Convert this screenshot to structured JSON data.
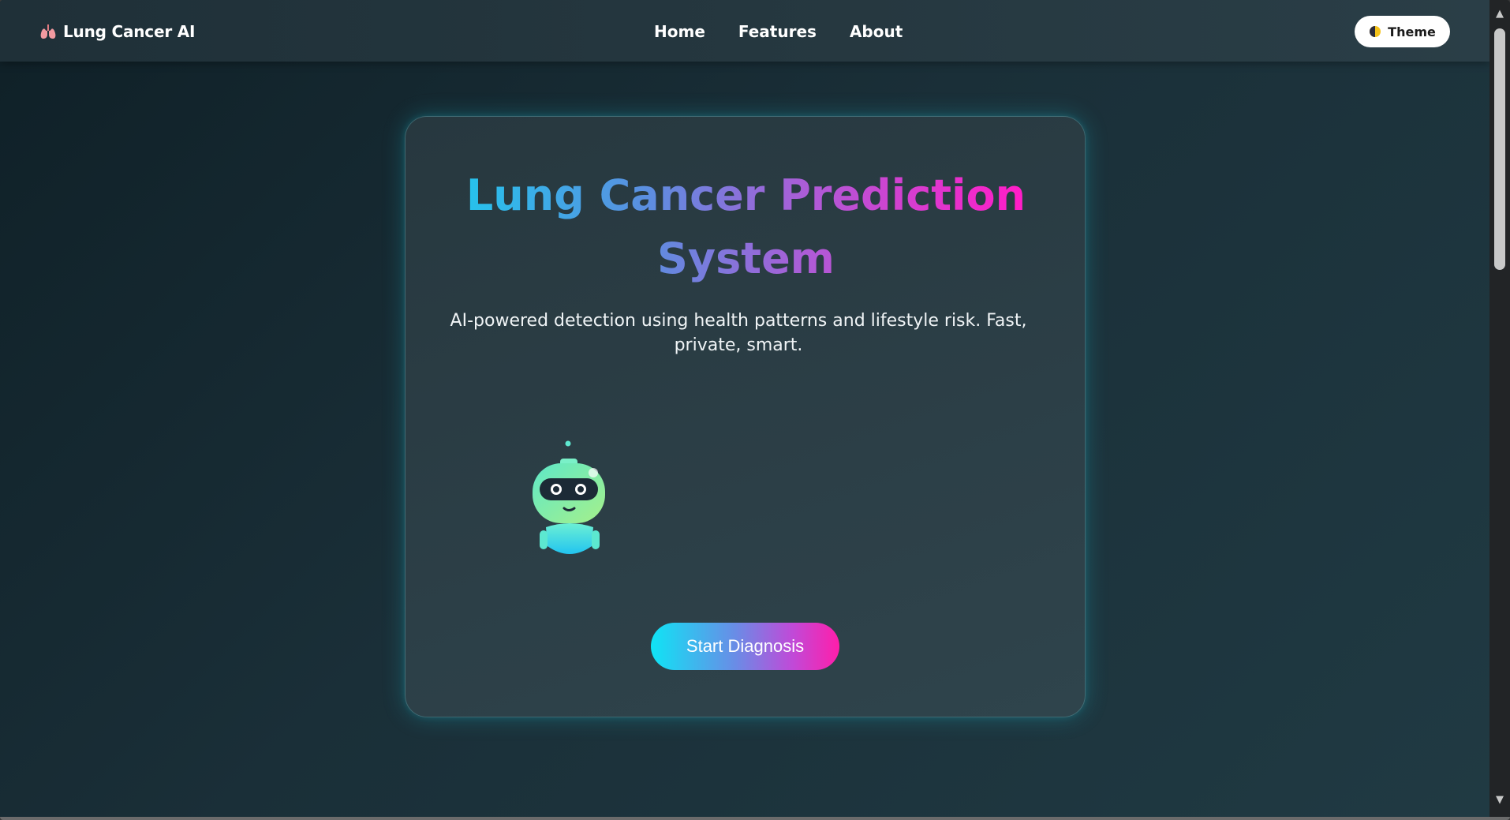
{
  "navbar": {
    "brand": {
      "icon": "lungs-icon",
      "label": "Lung Cancer AI"
    },
    "links": [
      {
        "label": "Home"
      },
      {
        "label": "Features"
      },
      {
        "label": "About"
      }
    ],
    "theme_button": {
      "icon": "half-circle-icon",
      "label": "Theme"
    }
  },
  "hero": {
    "title_line1_part1": "Lung Cancer ",
    "title_line1_part2": "Prediction",
    "title_line2": "System",
    "subtitle": "AI-powered detection using health patterns and lifestyle risk. Fast, private, smart.",
    "mascot": "robot-mascot-icon",
    "cta_label": "Start Diagnosis"
  },
  "colors": {
    "gradient_start": "#15d3f0",
    "gradient_end": "#ff1ec8",
    "card_glow": "#20c8dc",
    "page_bg": "#1a2f38"
  },
  "scrollbar": {
    "up_icon": "arrow-up-icon",
    "down_icon": "arrow-down-icon"
  }
}
